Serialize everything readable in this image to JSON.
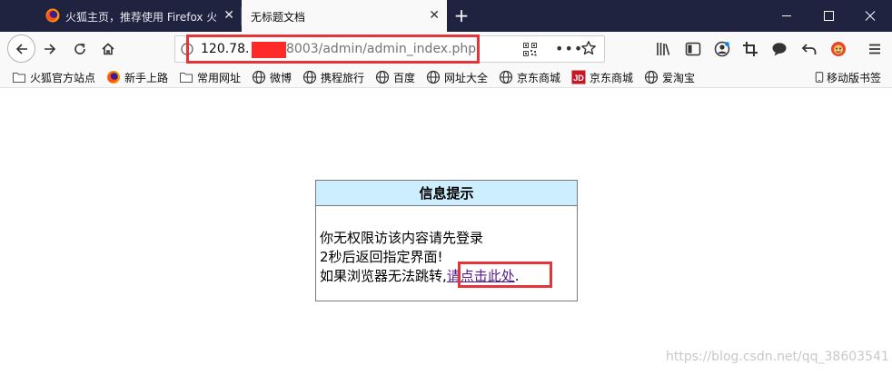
{
  "tabs": [
    {
      "title": "火狐主页，推荐使用 Firefox 火狐",
      "active": false
    },
    {
      "title": "无标题文档",
      "active": true
    }
  ],
  "urlbar": {
    "host_visible": "120.78.",
    "path_visible": "8003/admin/admin_index.php"
  },
  "bookmarks": [
    {
      "label": "火狐官方站点",
      "icon": "folder-icon"
    },
    {
      "label": "新手上路",
      "icon": "firefox-icon"
    },
    {
      "label": "常用网址",
      "icon": "folder-icon"
    },
    {
      "label": "微博",
      "icon": "globe-icon"
    },
    {
      "label": "携程旅行",
      "icon": "globe-icon"
    },
    {
      "label": "百度",
      "icon": "globe-icon"
    },
    {
      "label": "网址大全",
      "icon": "globe-icon"
    },
    {
      "label": "京东商城",
      "icon": "globe-icon"
    },
    {
      "label": "京东商城",
      "icon": "jd-icon"
    },
    {
      "label": "爱淘宝",
      "icon": "globe-icon"
    }
  ],
  "mobile_bookmarks": "移动版书签",
  "message": {
    "header": "信息提示",
    "line1": "你无权限访该内容请先登录",
    "line2": "2秒后返回指定界面!",
    "line3_prefix": "如果浏览器无法跳转,",
    "link_text": "请点击此处",
    "line3_suffix": "."
  },
  "watermark": "https://blog.csdn.net/qq_38603541",
  "colors": {
    "tabbar_bg": "#202340",
    "toolbar_bg": "#f9f9fa",
    "message_header_bg": "#cdeeff",
    "highlight_box": "#e3353a",
    "redaction": "#fe2a2a"
  }
}
